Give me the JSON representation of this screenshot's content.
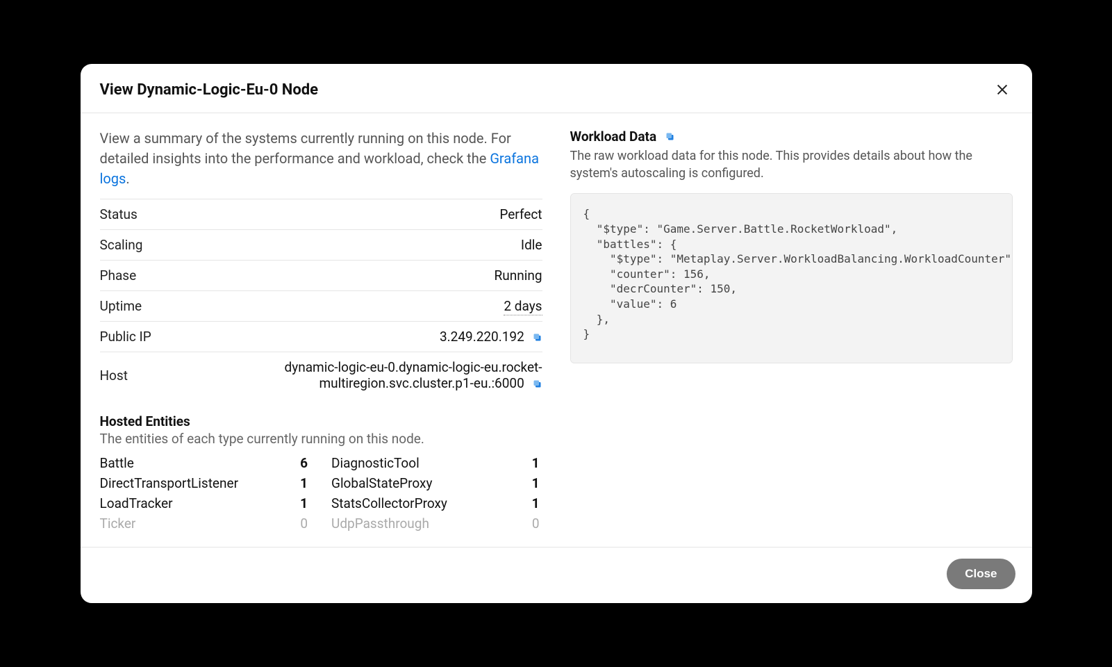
{
  "modal": {
    "title": "View Dynamic-Logic-Eu-0 Node",
    "close_icon": "close-icon",
    "footer_close_label": "Close"
  },
  "summary": {
    "text_part1": "View a summary of the systems currently running on this node. For detailed insights into the performance and workload, check the ",
    "link_label": "Grafana logs",
    "text_part2": "."
  },
  "node_info": {
    "status_label": "Status",
    "status_value": "Perfect",
    "scaling_label": "Scaling",
    "scaling_value": "Idle",
    "phase_label": "Phase",
    "phase_value": "Running",
    "uptime_label": "Uptime",
    "uptime_value": "2 days",
    "public_ip_label": "Public IP",
    "public_ip_value": "3.249.220.192",
    "host_label": "Host",
    "host_value": "dynamic-logic-eu-0.dynamic-logic-eu.rocket-multiregion.svc.cluster.p1-eu.:6000"
  },
  "hosted_entities": {
    "heading": "Hosted Entities",
    "subheading": "The entities of each type currently running on this node.",
    "left": [
      {
        "name": "Battle",
        "count": "6",
        "muted": false
      },
      {
        "name": "DirectTransportListener",
        "count": "1",
        "muted": false
      },
      {
        "name": "LoadTracker",
        "count": "1",
        "muted": false
      },
      {
        "name": "Ticker",
        "count": "0",
        "muted": true
      }
    ],
    "right": [
      {
        "name": "DiagnosticTool",
        "count": "1",
        "muted": false
      },
      {
        "name": "GlobalStateProxy",
        "count": "1",
        "muted": false
      },
      {
        "name": "StatsCollectorProxy",
        "count": "1",
        "muted": false
      },
      {
        "name": "UdpPassthrough",
        "count": "0",
        "muted": true
      }
    ]
  },
  "workload": {
    "heading": "Workload Data",
    "subheading": "The raw workload data for this node. This provides details about how the system's autoscaling is configured.",
    "code": "{\n  \"$type\": \"Game.Server.Battle.RocketWorkload\",\n  \"battles\": {\n    \"$type\": \"Metaplay.Server.WorkloadBalancing.WorkloadCounter\",\n    \"counter\": 156,\n    \"decrCounter\": 150,\n    \"value\": 6\n  },\n}"
  }
}
